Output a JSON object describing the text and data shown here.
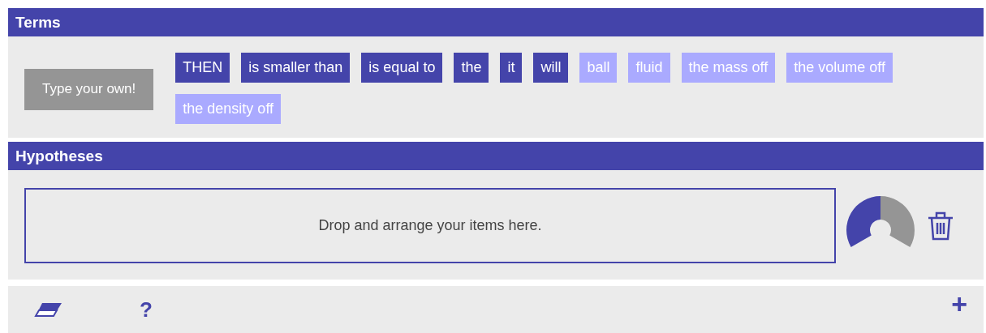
{
  "terms": {
    "title": "Terms",
    "type_button": "Type your own!",
    "items": [
      {
        "label": "THEN",
        "kind": "operator"
      },
      {
        "label": "is smaller than",
        "kind": "operator"
      },
      {
        "label": "is equal to",
        "kind": "operator"
      },
      {
        "label": "the",
        "kind": "operator"
      },
      {
        "label": "it",
        "kind": "operator"
      },
      {
        "label": "will",
        "kind": "operator"
      },
      {
        "label": "ball",
        "kind": "variable"
      },
      {
        "label": "fluid",
        "kind": "variable"
      },
      {
        "label": "the mass off",
        "kind": "variable"
      },
      {
        "label": "the volume off",
        "kind": "variable"
      },
      {
        "label": "the density off",
        "kind": "variable"
      }
    ]
  },
  "hypotheses": {
    "title": "Hypotheses",
    "drop_zone": "Drop and arrange your items here."
  },
  "toolbar": {
    "help": "?",
    "add": "+"
  }
}
